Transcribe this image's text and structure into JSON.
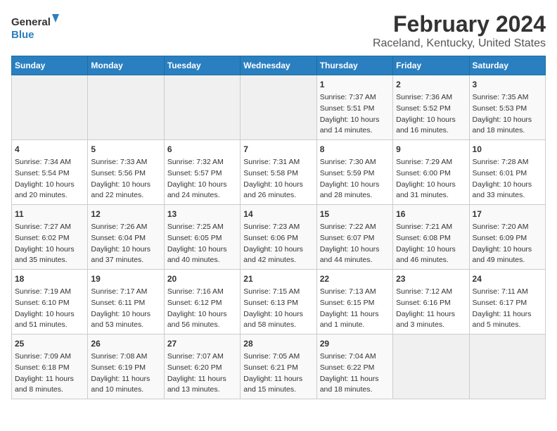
{
  "header": {
    "logo_line1": "General",
    "logo_line2": "Blue",
    "month_year": "February 2024",
    "location": "Raceland, Kentucky, United States"
  },
  "days_of_week": [
    "Sunday",
    "Monday",
    "Tuesday",
    "Wednesday",
    "Thursday",
    "Friday",
    "Saturday"
  ],
  "weeks": [
    [
      {
        "day": "",
        "info": ""
      },
      {
        "day": "",
        "info": ""
      },
      {
        "day": "",
        "info": ""
      },
      {
        "day": "",
        "info": ""
      },
      {
        "day": "1",
        "info": "Sunrise: 7:37 AM\nSunset: 5:51 PM\nDaylight: 10 hours\nand 14 minutes."
      },
      {
        "day": "2",
        "info": "Sunrise: 7:36 AM\nSunset: 5:52 PM\nDaylight: 10 hours\nand 16 minutes."
      },
      {
        "day": "3",
        "info": "Sunrise: 7:35 AM\nSunset: 5:53 PM\nDaylight: 10 hours\nand 18 minutes."
      }
    ],
    [
      {
        "day": "4",
        "info": "Sunrise: 7:34 AM\nSunset: 5:54 PM\nDaylight: 10 hours\nand 20 minutes."
      },
      {
        "day": "5",
        "info": "Sunrise: 7:33 AM\nSunset: 5:56 PM\nDaylight: 10 hours\nand 22 minutes."
      },
      {
        "day": "6",
        "info": "Sunrise: 7:32 AM\nSunset: 5:57 PM\nDaylight: 10 hours\nand 24 minutes."
      },
      {
        "day": "7",
        "info": "Sunrise: 7:31 AM\nSunset: 5:58 PM\nDaylight: 10 hours\nand 26 minutes."
      },
      {
        "day": "8",
        "info": "Sunrise: 7:30 AM\nSunset: 5:59 PM\nDaylight: 10 hours\nand 28 minutes."
      },
      {
        "day": "9",
        "info": "Sunrise: 7:29 AM\nSunset: 6:00 PM\nDaylight: 10 hours\nand 31 minutes."
      },
      {
        "day": "10",
        "info": "Sunrise: 7:28 AM\nSunset: 6:01 PM\nDaylight: 10 hours\nand 33 minutes."
      }
    ],
    [
      {
        "day": "11",
        "info": "Sunrise: 7:27 AM\nSunset: 6:02 PM\nDaylight: 10 hours\nand 35 minutes."
      },
      {
        "day": "12",
        "info": "Sunrise: 7:26 AM\nSunset: 6:04 PM\nDaylight: 10 hours\nand 37 minutes."
      },
      {
        "day": "13",
        "info": "Sunrise: 7:25 AM\nSunset: 6:05 PM\nDaylight: 10 hours\nand 40 minutes."
      },
      {
        "day": "14",
        "info": "Sunrise: 7:23 AM\nSunset: 6:06 PM\nDaylight: 10 hours\nand 42 minutes."
      },
      {
        "day": "15",
        "info": "Sunrise: 7:22 AM\nSunset: 6:07 PM\nDaylight: 10 hours\nand 44 minutes."
      },
      {
        "day": "16",
        "info": "Sunrise: 7:21 AM\nSunset: 6:08 PM\nDaylight: 10 hours\nand 46 minutes."
      },
      {
        "day": "17",
        "info": "Sunrise: 7:20 AM\nSunset: 6:09 PM\nDaylight: 10 hours\nand 49 minutes."
      }
    ],
    [
      {
        "day": "18",
        "info": "Sunrise: 7:19 AM\nSunset: 6:10 PM\nDaylight: 10 hours\nand 51 minutes."
      },
      {
        "day": "19",
        "info": "Sunrise: 7:17 AM\nSunset: 6:11 PM\nDaylight: 10 hours\nand 53 minutes."
      },
      {
        "day": "20",
        "info": "Sunrise: 7:16 AM\nSunset: 6:12 PM\nDaylight: 10 hours\nand 56 minutes."
      },
      {
        "day": "21",
        "info": "Sunrise: 7:15 AM\nSunset: 6:13 PM\nDaylight: 10 hours\nand 58 minutes."
      },
      {
        "day": "22",
        "info": "Sunrise: 7:13 AM\nSunset: 6:15 PM\nDaylight: 11 hours\nand 1 minute."
      },
      {
        "day": "23",
        "info": "Sunrise: 7:12 AM\nSunset: 6:16 PM\nDaylight: 11 hours\nand 3 minutes."
      },
      {
        "day": "24",
        "info": "Sunrise: 7:11 AM\nSunset: 6:17 PM\nDaylight: 11 hours\nand 5 minutes."
      }
    ],
    [
      {
        "day": "25",
        "info": "Sunrise: 7:09 AM\nSunset: 6:18 PM\nDaylight: 11 hours\nand 8 minutes."
      },
      {
        "day": "26",
        "info": "Sunrise: 7:08 AM\nSunset: 6:19 PM\nDaylight: 11 hours\nand 10 minutes."
      },
      {
        "day": "27",
        "info": "Sunrise: 7:07 AM\nSunset: 6:20 PM\nDaylight: 11 hours\nand 13 minutes."
      },
      {
        "day": "28",
        "info": "Sunrise: 7:05 AM\nSunset: 6:21 PM\nDaylight: 11 hours\nand 15 minutes."
      },
      {
        "day": "29",
        "info": "Sunrise: 7:04 AM\nSunset: 6:22 PM\nDaylight: 11 hours\nand 18 minutes."
      },
      {
        "day": "",
        "info": ""
      },
      {
        "day": "",
        "info": ""
      }
    ]
  ]
}
